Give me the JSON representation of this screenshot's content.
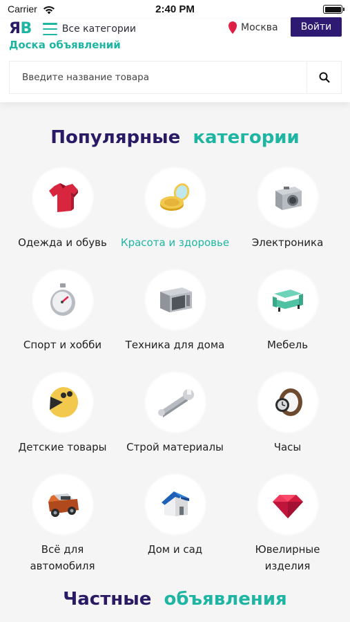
{
  "status_bar": {
    "carrier": "Carrier",
    "time": "2:40 PM"
  },
  "header": {
    "logo_part1": "Я",
    "logo_part2": "В",
    "menu_label": "Все категории",
    "tagline": "Доска объявлений",
    "city": "Москва",
    "login_label": "Войти"
  },
  "search": {
    "placeholder": "Введите название товара"
  },
  "popular": {
    "title_word1": "Популярные",
    "title_word2": "категории",
    "categories": [
      {
        "label": "Одежда и обувь",
        "icon": "tshirt-icon",
        "active": false
      },
      {
        "label": "Красота и здоровье",
        "icon": "compact-mirror-icon",
        "active": true
      },
      {
        "label": "Электроника",
        "icon": "camera-icon",
        "active": false
      },
      {
        "label": "Спорт и хобби",
        "icon": "stopwatch-icon",
        "active": false
      },
      {
        "label": "Техника для дома",
        "icon": "microwave-icon",
        "active": false
      },
      {
        "label": "Мебель",
        "icon": "sofa-icon",
        "active": false
      },
      {
        "label": "Детские товары",
        "icon": "pacman-toy-icon",
        "active": false
      },
      {
        "label": "Строй материалы",
        "icon": "wrench-icon",
        "active": false
      },
      {
        "label": "Часы",
        "icon": "wristwatch-icon",
        "active": false
      },
      {
        "label": "Всё для автомобиля",
        "icon": "suv-car-icon",
        "active": false
      },
      {
        "label": "Дом и сад",
        "icon": "house-icon",
        "active": false
      },
      {
        "label": "Ювелирные изделия",
        "icon": "gem-icon",
        "active": false
      }
    ]
  },
  "private_ads": {
    "title_word1": "Частные",
    "title_word2": "объявления"
  },
  "colors": {
    "brand_dark": "#2f1a73",
    "brand_teal": "#1fb5a3"
  }
}
